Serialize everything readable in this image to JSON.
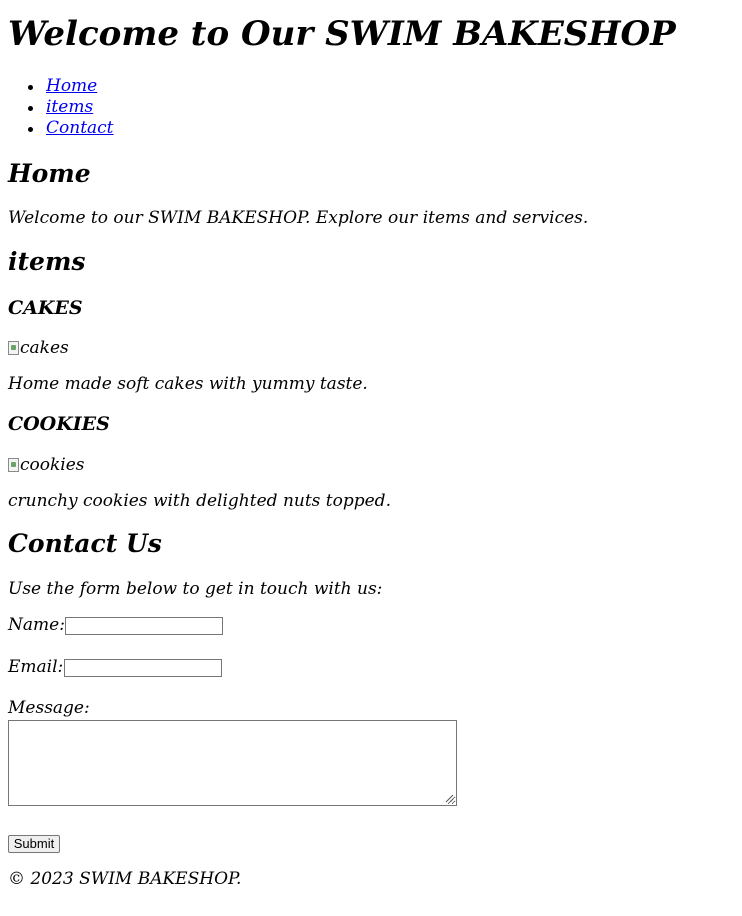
{
  "header": {
    "title": "Welcome to Our SWIM BAKESHOP"
  },
  "nav": {
    "items": [
      {
        "label": "Home"
      },
      {
        "label": "items"
      },
      {
        "label": "Contact"
      }
    ]
  },
  "home": {
    "heading": "Home",
    "text": "Welcome to our SWIM BAKESHOP. Explore our items and services."
  },
  "items": {
    "heading": "items",
    "products": [
      {
        "name": "CAKES",
        "image_alt": "cakes",
        "description": "Home made soft cakes with yummy taste."
      },
      {
        "name": "COOKIES",
        "image_alt": "cookies",
        "description": "crunchy cookies with delighted nuts topped."
      }
    ]
  },
  "contact": {
    "heading": "Contact Us",
    "intro": "Use the form below to get in touch with us:",
    "name_label": "Name:",
    "name_value": "",
    "email_label": "Email:",
    "email_value": "",
    "message_label": "Message:",
    "message_value": "",
    "submit_label": "Submit"
  },
  "footer": {
    "text": "© 2023 SWIM BAKESHOP."
  },
  "colors": {
    "link": "#0000ee",
    "text": "#000000",
    "background": "#ffffff"
  }
}
